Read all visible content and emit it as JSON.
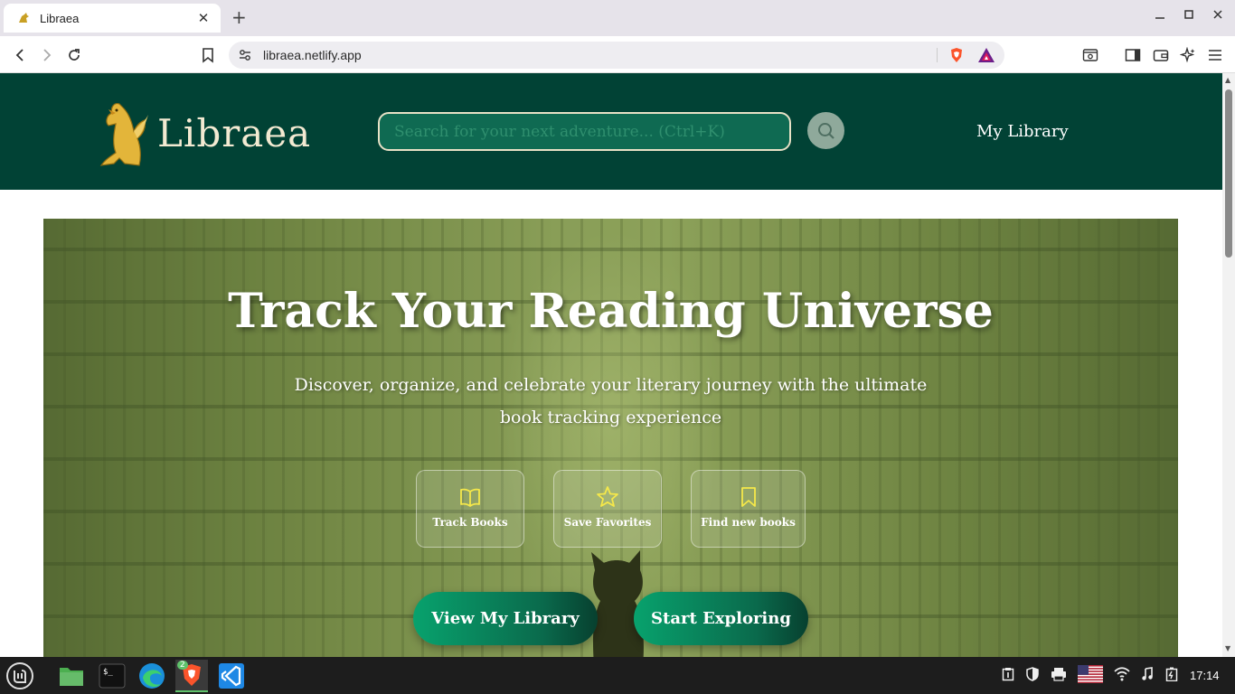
{
  "browser": {
    "tab_title": "Libraea",
    "url": "libraea.netlify.app",
    "new_tab_symbol": "+",
    "close_symbol": "✕"
  },
  "site": {
    "brand": "Libraea",
    "search_placeholder": "Search for your next adventure... (Ctrl+K)",
    "nav_my_library": "My Library"
  },
  "hero": {
    "title": "Track Your Reading Universe",
    "subtitle": "Discover, organize, and celebrate your literary journey with the ultimate book tracking experience",
    "features": [
      {
        "label": "Track Books",
        "icon": "book-open-icon"
      },
      {
        "label": "Save Favorites",
        "icon": "star-icon"
      },
      {
        "label": "Find new books",
        "icon": "bookmark-icon"
      }
    ],
    "buttons": {
      "view_library": "View My Library",
      "start_exploring": "Start Exploring"
    }
  },
  "taskbar": {
    "clock": "17:14",
    "badge_count": "2"
  },
  "colors": {
    "header_bg": "#014235",
    "accent_green": "#08a26d",
    "feature_icon": "#f5e84a"
  }
}
